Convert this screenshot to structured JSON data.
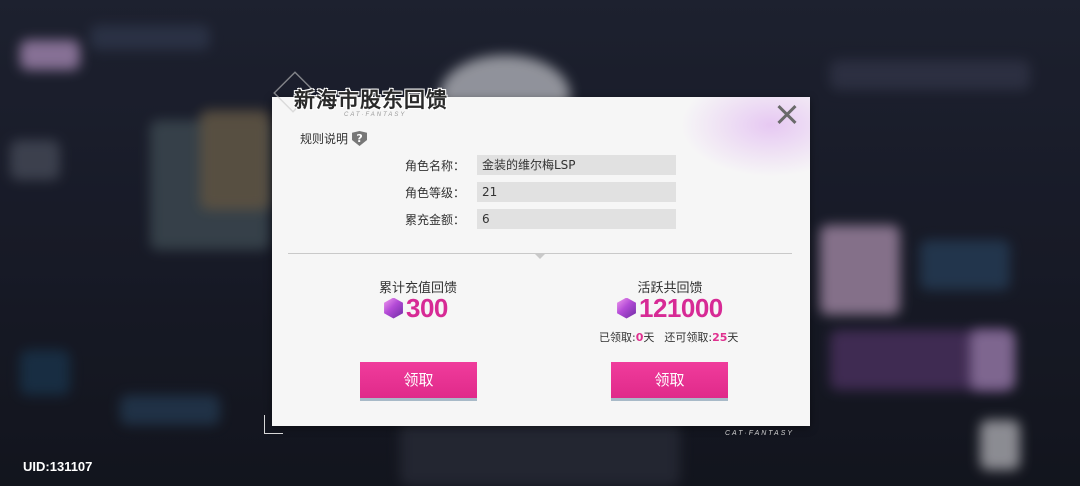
{
  "dialog": {
    "title": "新海市股东回馈",
    "subtitle": "CAT·FANTASY",
    "brand": "CAT·FANTASY",
    "rules_label": "规则说明",
    "help_icon": "?",
    "fields": [
      {
        "label": "角色名称：",
        "value": "金装的维尔梅LSP"
      },
      {
        "label": "角色等级：",
        "value": "21"
      },
      {
        "label": "累充金额：",
        "value": "6"
      }
    ],
    "recharge_reward": {
      "title": "累计充值回馈",
      "icon": "gem-icon",
      "value": "300",
      "button_label": "领取"
    },
    "activity_reward": {
      "title": "活跃共回馈",
      "icon": "gem-icon",
      "value": "121000",
      "claimed_label": "已领取:",
      "claimed_days": "0",
      "day_unit": "天",
      "remaining_label": "还可领取:",
      "remaining_days": "25",
      "button_label": "领取"
    },
    "accent_color": "#e02a8a"
  },
  "footer": {
    "uid": "UID:131107"
  }
}
